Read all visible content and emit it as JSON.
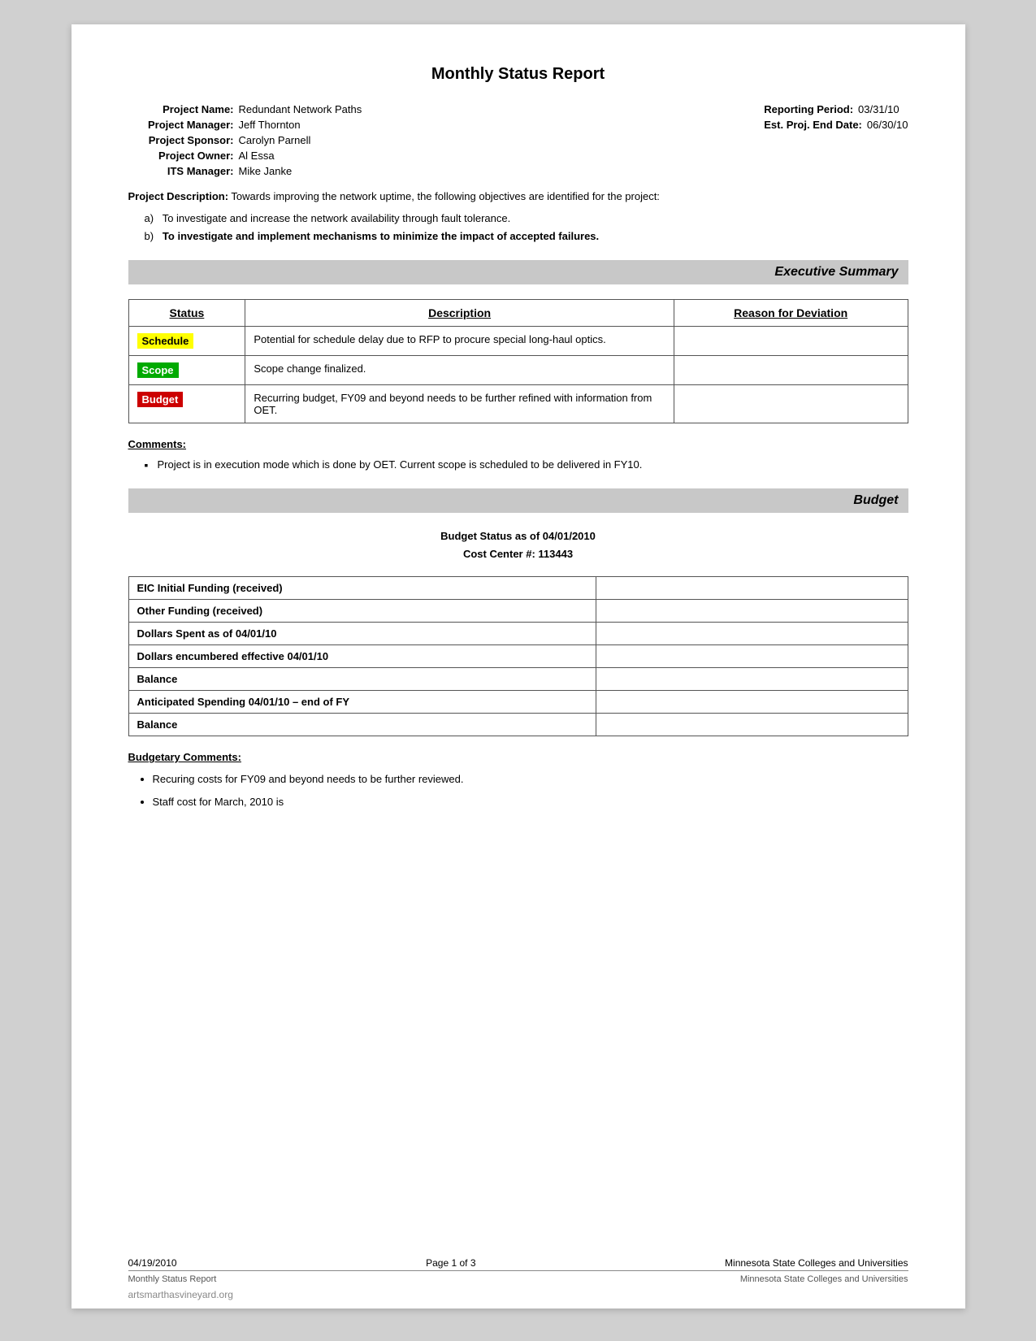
{
  "page": {
    "title": "Monthly Status Report",
    "project": {
      "name_label": "Project Name:",
      "name_value": "Redundant Network Paths",
      "manager_label": "Project Manager:",
      "manager_value": "Jeff Thornton",
      "sponsor_label": "Project Sponsor:",
      "sponsor_value": "Carolyn Parnell",
      "owner_label": "Project Owner:",
      "owner_value": "Al Essa",
      "its_label": "ITS Manager:",
      "its_value": "Mike Janke",
      "reporting_period_label": "Reporting Period:",
      "reporting_period_value": "03/31/10",
      "est_end_label": "Est. Proj. End Date:",
      "est_end_value": "06/30/10"
    },
    "description_label": "Project Description:",
    "description_text": "Towards improving the network uptime, the following objectives are identified for the project:",
    "description_items": [
      {
        "prefix": "a",
        "text": "To investigate and increase the network availability through fault tolerance."
      },
      {
        "prefix": "b",
        "text": "To investigate and implement mechanisms to minimize the impact of accepted failures."
      }
    ],
    "executive_summary": {
      "header": "Executive Summary",
      "table": {
        "col_status": "Status",
        "col_description": "Description",
        "col_reason": "Reason for Deviation",
        "rows": [
          {
            "status_label": "Schedule",
            "status_class": "yellow",
            "description": "Potential for schedule delay due to RFP to procure special long-haul optics.",
            "reason": ""
          },
          {
            "status_label": "Scope",
            "status_class": "green",
            "description": "Scope change finalized.",
            "reason": ""
          },
          {
            "status_label": "Budget",
            "status_class": "red",
            "description": "Recurring budget, FY09 and beyond needs to be further refined with information from OET.",
            "reason": ""
          }
        ]
      },
      "comments_label": "Comments:",
      "comments": [
        "Project is in execution mode which is done by OET.  Current scope is scheduled to be delivered in FY10."
      ]
    },
    "budget": {
      "header": "Budget",
      "status_title": "Budget Status as of  04/01/2010",
      "cost_center": "Cost Center #: 113443",
      "table_rows": [
        {
          "label": "EIC Initial Funding (received)",
          "value": ""
        },
        {
          "label": "Other Funding (received)",
          "value": ""
        },
        {
          "label": "Dollars Spent as of 04/01/10",
          "value": ""
        },
        {
          "label": "Dollars encumbered effective 04/01/10",
          "value": ""
        },
        {
          "label": "Balance",
          "value": ""
        },
        {
          "label": "Anticipated Spending 04/01/10 – end of FY",
          "value": ""
        },
        {
          "label": "Balance",
          "value": ""
        }
      ],
      "budgetary_comments_label": "Budgetary Comments:",
      "budgetary_comments": [
        "Recuring costs for FY09 and beyond needs to be further reviewed.",
        "Staff cost for March, 2010 is"
      ]
    },
    "footer": {
      "date": "04/19/2010",
      "page": "Page 1 of 3",
      "org": "Minnesota State Colleges and Universities",
      "doc_type": "Monthly Status Report"
    },
    "watermark": "artsmarthasvineyard.org"
  }
}
